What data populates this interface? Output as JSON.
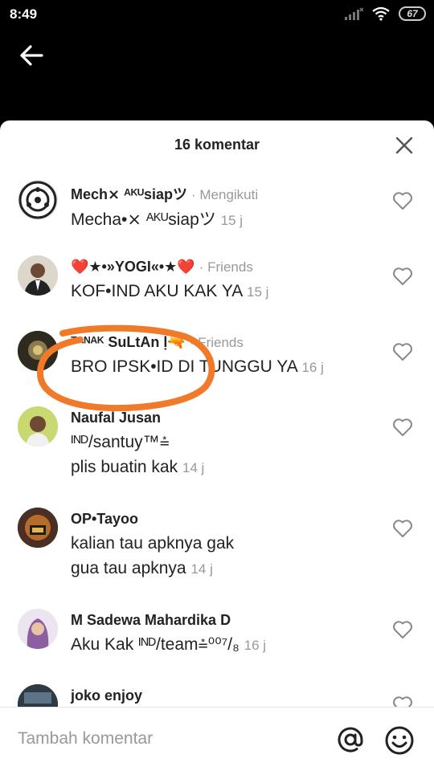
{
  "status": {
    "time": "8:49",
    "battery": "67"
  },
  "sheet": {
    "title": "16 komentar"
  },
  "comments": [
    {
      "name": "Mech⨯ ᴬᴷᵁsiapツ",
      "tag": "· Mengikuti",
      "text": "Mecha•⨯ ᴬᴷᵁsiapツ",
      "text2": "",
      "time": "15 j"
    },
    {
      "name": "❤️★•»YOGI«•★❤️",
      "tag": "· Friends",
      "text": "KOF•IND AKU KAK YA",
      "text2": "",
      "time": "15 j"
    },
    {
      "name": "ᵀᴬᴺᴬᴷ SuLtAn ḷ🔫",
      "tag": "· Friends",
      "text": "BRO IPSK•ID DI TUNGGU YA",
      "text2": "",
      "time": "16 j"
    },
    {
      "name": "Naufal Jusan",
      "tag": "",
      "text": "ᴵᴺᴰ/santuy™⩮",
      "text2": "plis buatin kak",
      "time": "14 j"
    },
    {
      "name": "OP•Tayoo",
      "tag": "",
      "text": "kalian tau apknya gak",
      "text2": "gua tau apknya",
      "time": "14 j"
    },
    {
      "name": "M Sadewa Mahardika D",
      "tag": "",
      "text": "Aku Kak ᴵᴺᴰ/team⩮⁰⁰⁷/₈",
      "text2": "",
      "time": "16 j"
    },
    {
      "name": "joko enjoy",
      "tag": "",
      "text": "",
      "text2": "",
      "time": ""
    }
  ],
  "input": {
    "placeholder": "Tambah komentar"
  },
  "colors": {
    "annotation": "#f07a2a",
    "muted": "#999999"
  }
}
